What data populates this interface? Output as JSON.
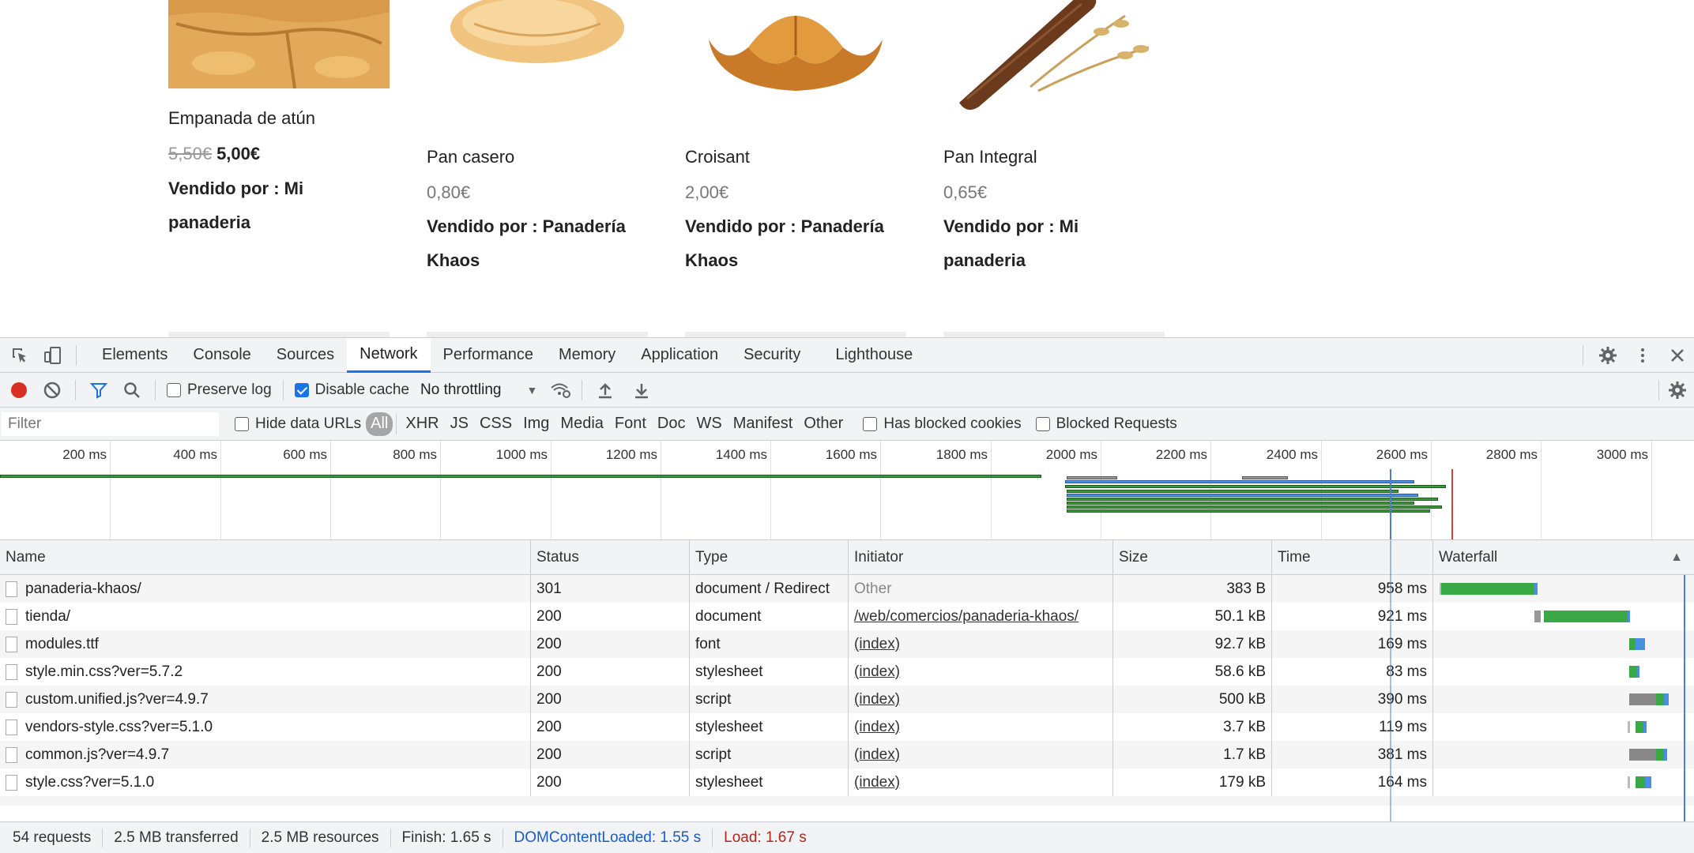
{
  "shop": {
    "products": [
      {
        "title": "Empanada de atún",
        "old_price": "5,50€",
        "price": "5,00€",
        "seller": "Vendido por : Mi panaderia"
      },
      {
        "title": "Pan casero",
        "old_price": "",
        "price": "0,80€",
        "seller": "Vendido por : Panadería Khaos"
      },
      {
        "title": "Croisant",
        "old_price": "",
        "price": "2,00€",
        "seller": "Vendido por : Panadería Khaos"
      },
      {
        "title": "Pan Integral",
        "old_price": "",
        "price": "0,65€",
        "seller": "Vendido por : Mi panaderia"
      }
    ]
  },
  "devtools": {
    "tabs": [
      "Elements",
      "Console",
      "Sources",
      "Network",
      "Performance",
      "Memory",
      "Application",
      "Security",
      "Lighthouse"
    ],
    "active_tab": "Network",
    "toolbar": {
      "preserve_log": "Preserve log",
      "disable_cache": "Disable cache",
      "throttling": "No throttling"
    },
    "filterbar": {
      "filter_placeholder": "Filter",
      "hide_data_urls": "Hide data URLs",
      "types": [
        "All",
        "XHR",
        "JS",
        "CSS",
        "Img",
        "Media",
        "Font",
        "Doc",
        "WS",
        "Manifest",
        "Other"
      ],
      "has_blocked_cookies": "Has blocked cookies",
      "blocked_requests": "Blocked Requests"
    },
    "overview": {
      "ticks": [
        "200 ms",
        "400 ms",
        "600 ms",
        "800 ms",
        "1000 ms",
        "1200 ms",
        "1400 ms",
        "1600 ms",
        "1800 ms",
        "2000 ms",
        "2200 ms",
        "2400 ms",
        "2600 ms",
        "2800 ms",
        "3000 ms"
      ]
    },
    "table": {
      "columns": [
        "Name",
        "Status",
        "Type",
        "Initiator",
        "Size",
        "Time",
        "Waterfall"
      ],
      "rows": [
        {
          "name": "panaderia-khaos/",
          "status": "301",
          "type": "document / Redirect",
          "initiator": "Other",
          "size": "383 B",
          "time": "958 ms"
        },
        {
          "name": "tienda/",
          "status": "200",
          "type": "document",
          "initiator": "/web/comercios/panaderia-khaos/",
          "size": "50.1 kB",
          "time": "921 ms"
        },
        {
          "name": "modules.ttf",
          "status": "200",
          "type": "font",
          "initiator": "(index)",
          "size": "92.7 kB",
          "time": "169 ms"
        },
        {
          "name": "style.min.css?ver=5.7.2",
          "status": "200",
          "type": "stylesheet",
          "initiator": "(index)",
          "size": "58.6 kB",
          "time": "83 ms"
        },
        {
          "name": "custom.unified.js?ver=4.9.7",
          "status": "200",
          "type": "script",
          "initiator": "(index)",
          "size": "500 kB",
          "time": "390 ms"
        },
        {
          "name": "vendors-style.css?ver=5.1.0",
          "status": "200",
          "type": "stylesheet",
          "initiator": "(index)",
          "size": "3.7 kB",
          "time": "119 ms"
        },
        {
          "name": "common.js?ver=4.9.7",
          "status": "200",
          "type": "script",
          "initiator": "(index)",
          "size": "1.7 kB",
          "time": "381 ms"
        },
        {
          "name": "style.css?ver=5.1.0",
          "status": "200",
          "type": "stylesheet",
          "initiator": "(index)",
          "size": "179 kB",
          "time": "164 ms"
        }
      ]
    },
    "statusbar": {
      "requests": "54 requests",
      "transferred": "2.5 MB transferred",
      "resources": "2.5 MB resources",
      "finish": "Finish: 1.65 s",
      "dom_content_loaded": "DOMContentLoaded: 1.55 s",
      "load": "Load: 1.67 s"
    }
  }
}
